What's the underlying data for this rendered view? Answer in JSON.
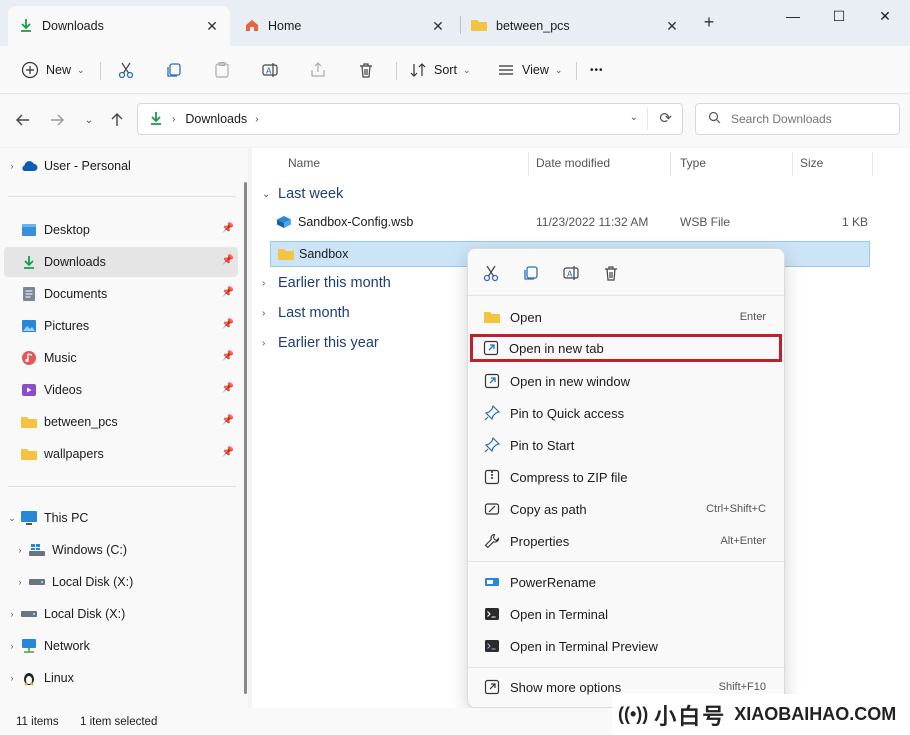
{
  "tabs": [
    {
      "label": "Downloads",
      "close": "✕"
    },
    {
      "label": "Home",
      "close": "✕"
    },
    {
      "label": "between_pcs",
      "close": "✕"
    }
  ],
  "new_tab_glyph": "+",
  "window_controls": {
    "minimize": "—",
    "maximize": "☐",
    "close": "✕"
  },
  "toolbar": {
    "new_label": "New",
    "sort_label": "Sort",
    "view_label": "View",
    "more_glyph": "•••"
  },
  "address": {
    "crumb": "Downloads",
    "refresh_glyph": "⟳"
  },
  "search": {
    "placeholder": "Search Downloads"
  },
  "sidebar": {
    "items": [
      {
        "label": "User - Personal"
      },
      {
        "label": "Desktop"
      },
      {
        "label": "Downloads"
      },
      {
        "label": "Documents"
      },
      {
        "label": "Pictures"
      },
      {
        "label": "Music"
      },
      {
        "label": "Videos"
      },
      {
        "label": "between_pcs"
      },
      {
        "label": "wallpapers"
      },
      {
        "label": "This PC"
      },
      {
        "label": "Windows (C:)"
      },
      {
        "label": "Local Disk (X:)"
      },
      {
        "label": "Local Disk (X:)"
      },
      {
        "label": "Network"
      },
      {
        "label": "Linux"
      }
    ]
  },
  "columns": {
    "name": "Name",
    "date": "Date modified",
    "type": "Type",
    "size": "Size"
  },
  "groups": {
    "last_week": "Last week",
    "earlier_month": "Earlier this month",
    "last_month": "Last month",
    "earlier_year": "Earlier this year"
  },
  "files": [
    {
      "name": "Sandbox-Config.wsb",
      "date": "11/23/2022 11:32 AM",
      "type": "WSB File",
      "size": "1 KB"
    },
    {
      "name": "Sandbox",
      "date": "",
      "type": "",
      "size": ""
    }
  ],
  "context_menu": {
    "items": [
      {
        "label": "Open",
        "shortcut": "Enter"
      },
      {
        "label": "Open in new tab",
        "shortcut": ""
      },
      {
        "label": "Open in new window",
        "shortcut": ""
      },
      {
        "label": "Pin to Quick access",
        "shortcut": ""
      },
      {
        "label": "Pin to Start",
        "shortcut": ""
      },
      {
        "label": "Compress to ZIP file",
        "shortcut": ""
      },
      {
        "label": "Copy as path",
        "shortcut": "Ctrl+Shift+C"
      },
      {
        "label": "Properties",
        "shortcut": "Alt+Enter"
      },
      {
        "label": "PowerRename",
        "shortcut": ""
      },
      {
        "label": "Open in Terminal",
        "shortcut": ""
      },
      {
        "label": "Open in Terminal Preview",
        "shortcut": ""
      },
      {
        "label": "Show more options",
        "shortcut": "Shift+F10"
      }
    ]
  },
  "status": {
    "count": "11 items",
    "selected": "1 item selected"
  },
  "watermark": {
    "cn": "小白号",
    "en": "XIAOBAIHAO.COM"
  },
  "colors": {
    "accent": "#0067c0",
    "folder": "#f5c342",
    "highlight_border": "#c0202a",
    "selection": "#cce4f7"
  }
}
